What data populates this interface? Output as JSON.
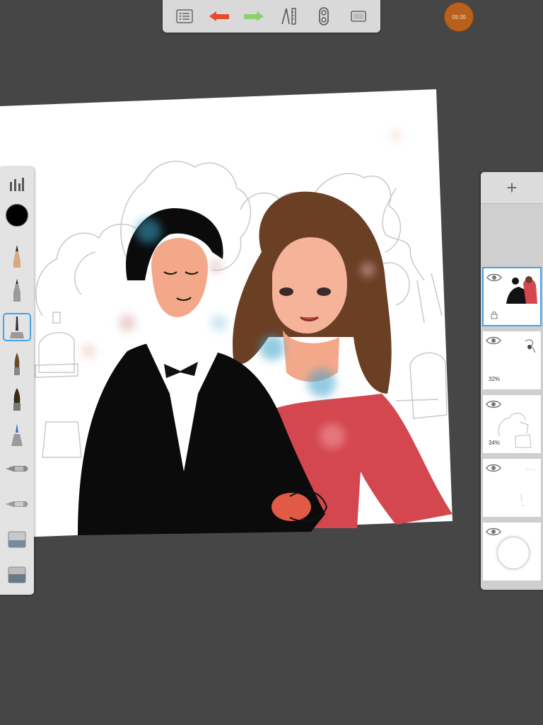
{
  "status": {
    "clock": "09:39"
  },
  "toolbar": {
    "items": [
      {
        "name": "menu-list",
        "icon": "list-icon"
      },
      {
        "name": "undo",
        "icon": "undo-arrow-icon",
        "color": "#e74c2a"
      },
      {
        "name": "redo",
        "icon": "redo-arrow-icon",
        "color": "#8ecf72"
      },
      {
        "name": "guides",
        "icon": "ruler-compass-icon"
      },
      {
        "name": "symmetry",
        "icon": "symmetry-icon"
      },
      {
        "name": "fullscreen",
        "icon": "fullscreen-icon"
      }
    ]
  },
  "tools": [
    {
      "name": "brush-library",
      "icon": "brush-library-icon"
    },
    {
      "name": "color",
      "icon": "color-swatch",
      "color": "#000000"
    },
    {
      "name": "pencil",
      "icon": "pencil-icon"
    },
    {
      "name": "ballpoint",
      "icon": "ballpoint-pen-icon"
    },
    {
      "name": "marker",
      "icon": "marker-icon",
      "selected": true
    },
    {
      "name": "paintbrush",
      "icon": "paintbrush-icon"
    },
    {
      "name": "dark-brush",
      "icon": "dark-brush-icon"
    },
    {
      "name": "airbrush",
      "icon": "airbrush-icon"
    },
    {
      "name": "smudge",
      "icon": "smudge-icon"
    },
    {
      "name": "blender",
      "icon": "blender-icon"
    },
    {
      "name": "eraser",
      "icon": "eraser-icon"
    },
    {
      "name": "hard-eraser",
      "icon": "hard-eraser-icon"
    }
  ],
  "layers": {
    "add_label": "+",
    "items": [
      {
        "name": "layer-color",
        "opacity": "",
        "active": true
      },
      {
        "name": "layer-2",
        "opacity": "32%"
      },
      {
        "name": "layer-3",
        "opacity": "34%"
      },
      {
        "name": "layer-4",
        "opacity": ""
      },
      {
        "name": "background-layer",
        "opacity": ""
      }
    ]
  },
  "colors": {
    "accent": "#44a3ea",
    "dress": "#d4474f",
    "hair": "#6b3f24",
    "skin": "#f4a88a",
    "suit": "#0b0b0b"
  }
}
